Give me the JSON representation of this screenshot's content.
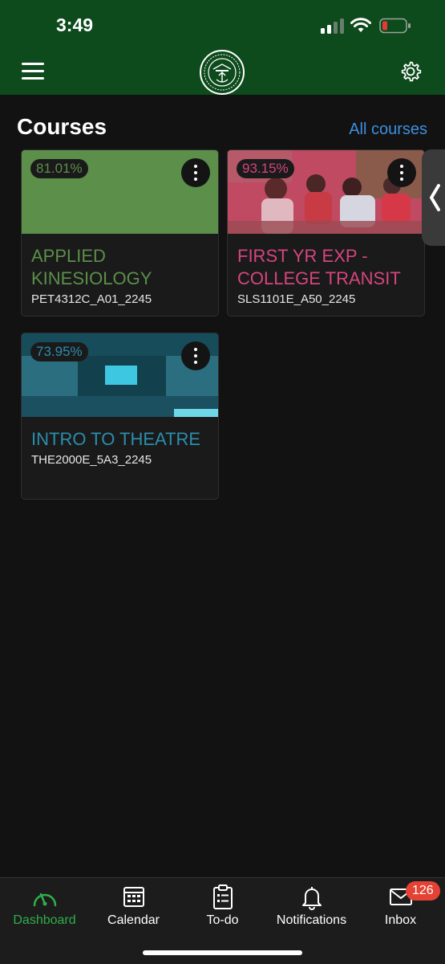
{
  "status_bar": {
    "time": "3:49",
    "icons": [
      "cellular-signal-icon",
      "wifi-icon",
      "battery-low-icon"
    ],
    "battery_color": "#e53935"
  },
  "header": {
    "background": "#0d4a1c",
    "menu_icon": "hamburger-menu-icon",
    "logo": "university-seal-logo",
    "settings_icon": "gear-icon"
  },
  "courses_section": {
    "title": "Courses",
    "all_courses_link": "All courses",
    "link_color": "#3d8fe0"
  },
  "courses": [
    {
      "grade": "81.01%",
      "name": "APPLIED KINESIOLOGY",
      "code": "PET4312C_A01_2245",
      "color": "#5b8f4a",
      "image": "solid-green"
    },
    {
      "grade": "93.15%",
      "name": "FIRST YR EXP - COLLEGE TRANSIT",
      "code": "SLS1101E_A50_2245",
      "color": "#d6457e",
      "image": "students-outdoors-photo"
    },
    {
      "grade": "73.95%",
      "name": "INTRO TO THEATRE",
      "code": "THE2000E_5A3_2245",
      "color": "#2b8ead",
      "image": "theatre-auditorium-photo"
    }
  ],
  "tabbar": {
    "active_color": "#2fae4a",
    "tabs": [
      {
        "label": "Dashboard",
        "icon": "dashboard-gauge-icon",
        "active": true
      },
      {
        "label": "Calendar",
        "icon": "calendar-icon",
        "active": false
      },
      {
        "label": "To-do",
        "icon": "todo-clipboard-icon",
        "active": false
      },
      {
        "label": "Notifications",
        "icon": "bell-icon",
        "active": false
      },
      {
        "label": "Inbox",
        "icon": "envelope-icon",
        "active": false
      }
    ],
    "inbox_badge": "126"
  }
}
